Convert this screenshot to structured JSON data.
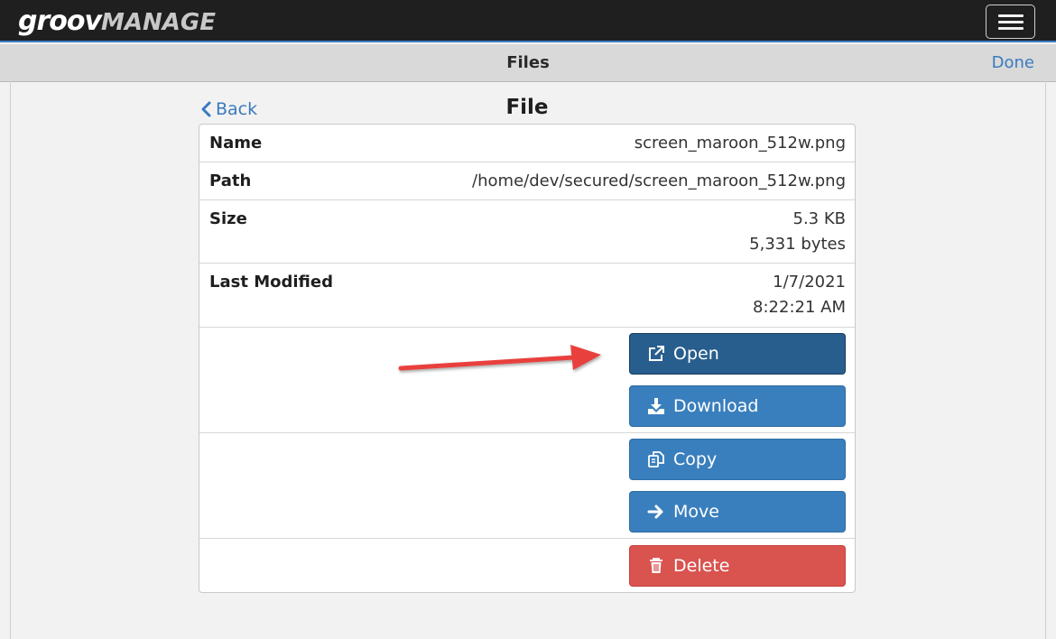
{
  "brand": {
    "part1": "groov",
    "part2": "MANAGE"
  },
  "header": {
    "title": "Files",
    "done_label": "Done"
  },
  "nav": {
    "back_label": "Back"
  },
  "page": {
    "heading": "File"
  },
  "file": {
    "name_label": "Name",
    "name_value": "screen_maroon_512w.png",
    "path_label": "Path",
    "path_value": "/home/dev/secured/screen_maroon_512w.png",
    "size_label": "Size",
    "size_value_kb": "5.3 KB",
    "size_value_bytes": "5,331 bytes",
    "modified_label": "Last Modified",
    "modified_date": "1/7/2021",
    "modified_time": "8:22:21 AM"
  },
  "actions": {
    "open": "Open",
    "download": "Download",
    "copy": "Copy",
    "move": "Move",
    "delete": "Delete"
  },
  "colors": {
    "primary": "#3a7fbd",
    "primary_active": "#285e8e",
    "danger": "#d9534f",
    "link": "#3a7abf",
    "annotation_arrow": "#e8413e"
  },
  "icons": {
    "open": "external-link-icon",
    "download": "download-icon",
    "copy": "copy-icon",
    "move": "arrow-right-icon",
    "delete": "trash-icon",
    "back": "chevron-left-icon",
    "menu": "hamburger-icon"
  }
}
